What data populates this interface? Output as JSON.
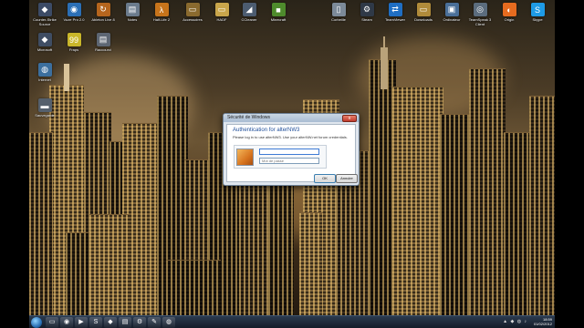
{
  "desktop": {
    "icons": [
      {
        "label": "Counter-Strike Source",
        "icon": "cs-icon",
        "glyph": "◆",
        "color": "#3c4b66"
      },
      {
        "label": "Vuze Pro 2.0",
        "icon": "vuze-icon",
        "glyph": "◉",
        "color": "#2b6fb5"
      },
      {
        "label": "Ableton Live 8",
        "icon": "live-icon",
        "glyph": "↻",
        "color": "#b5651d"
      },
      {
        "label": "Notes",
        "icon": "document-icon",
        "glyph": "▤",
        "color": "#6b7b8c"
      },
      {
        "label": "Half-Life 2",
        "icon": "hl2-icon",
        "glyph": "λ",
        "color": "#c7741b"
      },
      {
        "label": "Accessoires",
        "icon": "folder-icon",
        "glyph": "▭",
        "color": "#8a6a2e"
      },
      {
        "label": "HADF",
        "icon": "folder-icon",
        "glyph": "▭",
        "color": "#c9a64b"
      },
      {
        "label": "CCleaner",
        "icon": "cleaner-icon",
        "glyph": "◢",
        "color": "#4c5c70"
      },
      {
        "label": "Minecraft",
        "icon": "minecraft-icon",
        "glyph": "■",
        "color": "#4e8b2c"
      },
      {
        "label": "Corbeille",
        "icon": "recycle-bin-icon",
        "glyph": "▯",
        "color": "#7c8a99"
      },
      {
        "label": "Steam",
        "icon": "steam-icon",
        "glyph": "⚙",
        "color": "#2f3947"
      },
      {
        "label": "TeamViewer",
        "icon": "teamviewer-icon",
        "glyph": "⇄",
        "color": "#1f6ec2"
      },
      {
        "label": "Downloads",
        "icon": "folder-icon",
        "glyph": "▭",
        "color": "#b08b3a"
      },
      {
        "label": "Ordinateur",
        "icon": "computer-icon",
        "glyph": "▣",
        "color": "#4a6f98"
      },
      {
        "label": "TeamSpeak 3 Client",
        "icon": "teamspeak-icon",
        "glyph": "◎",
        "color": "#5b6c7d"
      },
      {
        "label": "Origin",
        "icon": "origin-icon",
        "glyph": "◐",
        "color": "#e66b1f"
      },
      {
        "label": "Skype",
        "icon": "skype-icon",
        "glyph": "S",
        "color": "#1e9be6"
      },
      {
        "label": "Microsoft",
        "icon": "app-icon",
        "glyph": "◆",
        "color": "#3f4d63"
      },
      {
        "label": "Fraps",
        "icon": "fraps-icon",
        "glyph": "99",
        "color": "#c9b62a"
      },
      {
        "label": "Raccourci",
        "icon": "shortcut-icon",
        "glyph": "▤",
        "color": "#5d6673"
      },
      {
        "label": "Internet",
        "icon": "globe-icon",
        "glyph": "◍",
        "color": "#3c6f9e"
      },
      {
        "label": "Sauvegarde",
        "icon": "drive-icon",
        "glyph": "▬",
        "color": "#55606d"
      }
    ]
  },
  "dialog": {
    "window_title": "Sécurité de Windows",
    "close_glyph": "x",
    "heading": "Authentication for alterNW3",
    "description": "Please log in to use alterNW3. Use your alterNW.net forum credentials.",
    "username_placeholder": "",
    "password_placeholder": "Mot de passe",
    "ok_label": "OK",
    "cancel_label": "Annuler"
  },
  "taskbar": {
    "items": [
      {
        "icon": "explorer-icon",
        "glyph": "▭"
      },
      {
        "icon": "firefox-icon",
        "glyph": "◉"
      },
      {
        "icon": "media-player-icon",
        "glyph": "▶"
      },
      {
        "icon": "skype-icon",
        "glyph": "S"
      },
      {
        "icon": "app-icon",
        "glyph": "◆"
      },
      {
        "icon": "folder-icon",
        "glyph": "▤"
      },
      {
        "icon": "steam-icon",
        "glyph": "⚙"
      },
      {
        "icon": "paint-icon",
        "glyph": "✎"
      },
      {
        "icon": "network-icon",
        "glyph": "◍"
      }
    ],
    "tray_icons": "▲ ◆ ◍ ♪",
    "time": "18:59",
    "date": "01/02/2012"
  }
}
